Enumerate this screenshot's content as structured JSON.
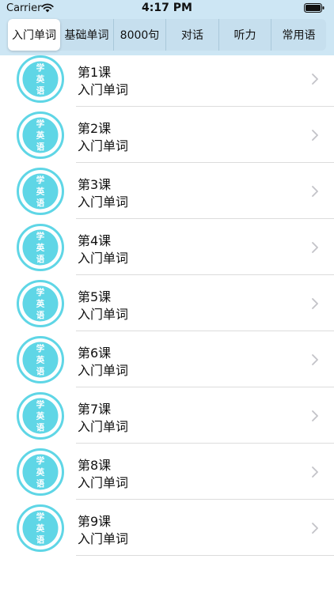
{
  "status_bar": {
    "carrier": "Carrier",
    "time": "4:17 PM"
  },
  "tabs": [
    {
      "label": "入门单词",
      "active": true
    },
    {
      "label": "基础单词",
      "active": false
    },
    {
      "label": "8000句",
      "active": false
    },
    {
      "label": "对话",
      "active": false
    },
    {
      "label": "听力",
      "active": false
    },
    {
      "label": "常用语",
      "active": false
    }
  ],
  "logo_text": [
    "学",
    "英",
    "语"
  ],
  "lessons": [
    {
      "title": "第1课",
      "subtitle": "入门单词"
    },
    {
      "title": "第2课",
      "subtitle": "入门单词"
    },
    {
      "title": "第3课",
      "subtitle": "入门单词"
    },
    {
      "title": "第4课",
      "subtitle": "入门单词"
    },
    {
      "title": "第5课",
      "subtitle": "入门单词"
    },
    {
      "title": "第6课",
      "subtitle": "入门单词"
    },
    {
      "title": "第7课",
      "subtitle": "入门单词"
    },
    {
      "title": "第8课",
      "subtitle": "入门单词"
    },
    {
      "title": "第9课",
      "subtitle": "入门单词"
    }
  ],
  "colors": {
    "header_bg": "#cde6f4",
    "logo_fill": "#5fd6e6",
    "logo_ring": "#5fd6e6",
    "divider": "#dcdcdc",
    "chevron": "#c3c3c8"
  }
}
